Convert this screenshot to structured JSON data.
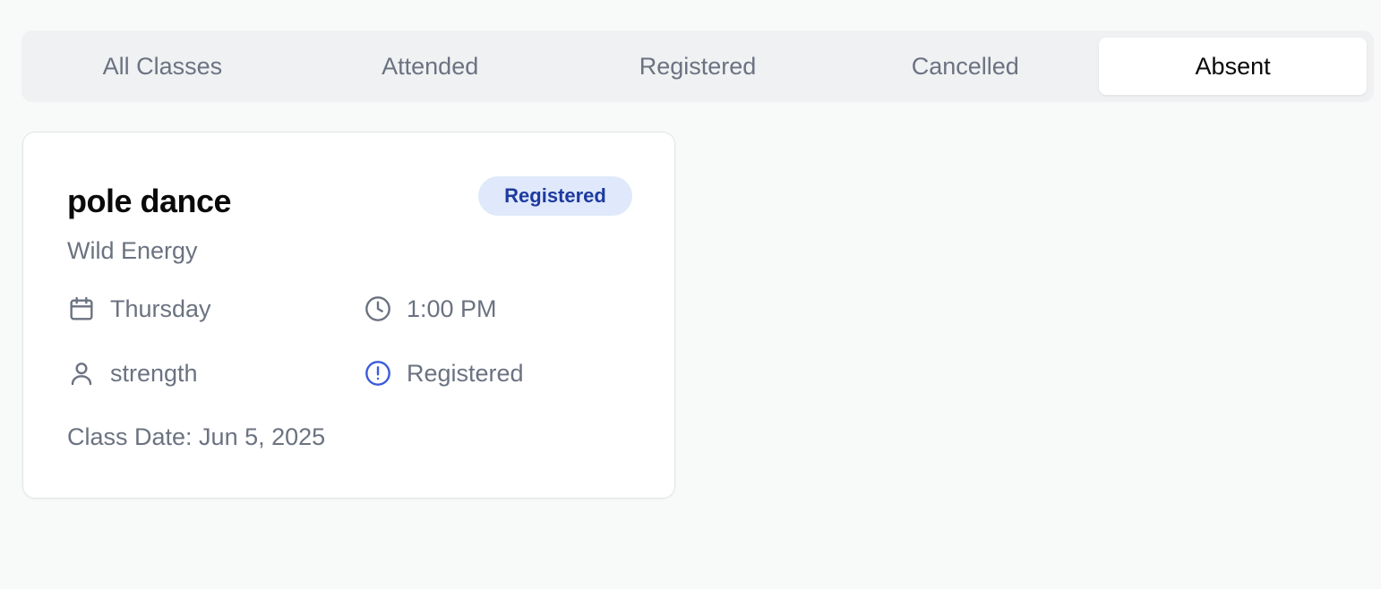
{
  "tabs": [
    {
      "label": "All Classes",
      "active": false
    },
    {
      "label": "Attended",
      "active": false
    },
    {
      "label": "Registered",
      "active": false
    },
    {
      "label": "Cancelled",
      "active": false
    },
    {
      "label": "Absent",
      "active": true
    }
  ],
  "card": {
    "title": "pole dance",
    "badge": "Registered",
    "subtitle": "Wild Energy",
    "day": "Thursday",
    "time": "1:00 PM",
    "category": "strength",
    "status": "Registered",
    "class_date": "Class Date: Jun 5, 2025"
  },
  "icons": {
    "day": "calendar-icon",
    "time": "clock-icon",
    "category": "user-icon",
    "status": "alert-circle-icon"
  },
  "colors": {
    "badge_bg": "#dfe9fb",
    "badge_text": "#1e3a9f",
    "status_icon": "#3b5bdb",
    "muted_text": "#6b7280"
  }
}
